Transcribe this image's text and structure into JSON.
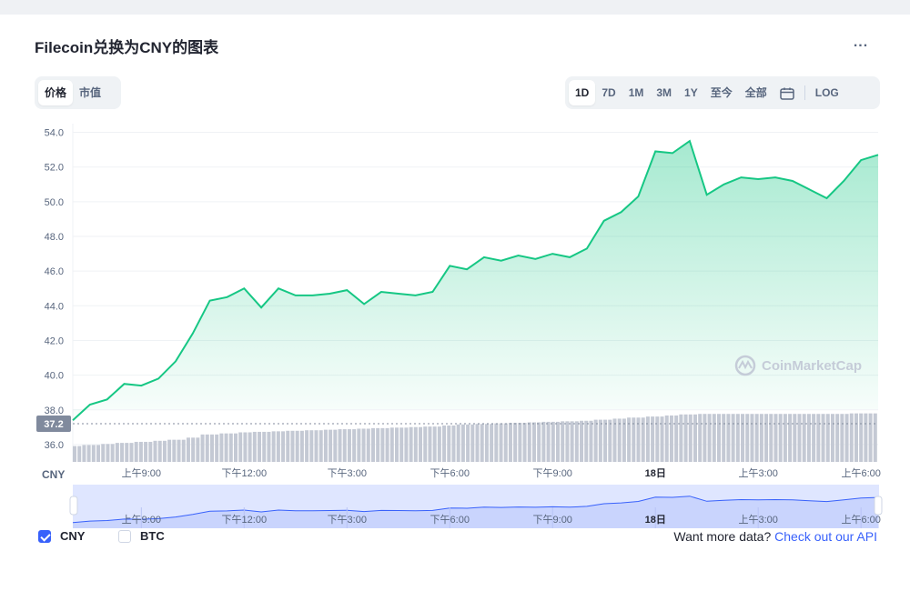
{
  "title": "Filecoin兑换为CNY的图表",
  "more_label": "...",
  "tabs_left": [
    {
      "label": "价格",
      "active": true
    },
    {
      "label": "市值",
      "active": false
    }
  ],
  "tabs_right": [
    {
      "label": "1D",
      "active": true
    },
    {
      "label": "7D",
      "active": false
    },
    {
      "label": "1M",
      "active": false
    },
    {
      "label": "3M",
      "active": false
    },
    {
      "label": "1Y",
      "active": false
    },
    {
      "label": "至今",
      "active": false
    },
    {
      "label": "全部",
      "active": false
    }
  ],
  "log_label": "LOG",
  "watermark": "CoinMarketCap",
  "currency_label": "CNY",
  "colors": {
    "line": "#16c784",
    "area_top": "#16c784",
    "volume": "#c4c9d4",
    "navigator_fill": "#dfe6ff",
    "navigator_line": "#3861fb",
    "accent": "#3861fb"
  },
  "chart_data": {
    "type": "line",
    "xlabel": "",
    "ylabel": "",
    "ylim": [
      35,
      54.5
    ],
    "yticks": [
      "54.0",
      "52.0",
      "50.0",
      "48.0",
      "46.0",
      "44.0",
      "42.0",
      "40.0",
      "38.0",
      "36.0"
    ],
    "ytick_values": [
      54,
      52,
      50,
      48,
      46,
      44,
      42,
      40,
      38,
      36
    ],
    "xticks": [
      "上午9:00",
      "下午12:00",
      "下午3:00",
      "下午6:00",
      "下午9:00",
      "18日",
      "上午3:00",
      "上午6:00"
    ],
    "xtick_hours": [
      2,
      5,
      8,
      11,
      14,
      17,
      20,
      23
    ],
    "baseline_label": "37.2",
    "baseline_value": 37.2,
    "x_hours": [
      0,
      0.5,
      1,
      1.5,
      2,
      2.5,
      3,
      3.5,
      4,
      4.5,
      5,
      5.5,
      6,
      6.5,
      7,
      7.5,
      8,
      8.5,
      9,
      9.5,
      10,
      10.5,
      11,
      11.5,
      12,
      12.5,
      13,
      13.5,
      14,
      14.5,
      15,
      15.5,
      16,
      16.5,
      17,
      17.5,
      18,
      18.5,
      19,
      19.5,
      20,
      20.5,
      21,
      21.5,
      22,
      22.5,
      23,
      23.5
    ],
    "series": [
      {
        "values": [
          37.4,
          38.3,
          38.6,
          39.5,
          39.4,
          39.8,
          40.8,
          42.4,
          44.3,
          44.5,
          45.0,
          43.9,
          45.0,
          44.6,
          44.6,
          44.7,
          44.9,
          44.1,
          44.8,
          44.7,
          44.6,
          44.8,
          46.3,
          46.1,
          46.8,
          46.6,
          46.9,
          46.7,
          47.0,
          46.8,
          47.3,
          48.9,
          49.4,
          50.3,
          52.9,
          52.8,
          53.5,
          50.4,
          51.0,
          51.4,
          51.3,
          51.4,
          51.2,
          50.7,
          50.2,
          51.2,
          52.4,
          52.7
        ],
        "volume": [
          0.3,
          0.32,
          0.34,
          0.36,
          0.38,
          0.4,
          0.42,
          0.46,
          0.52,
          0.54,
          0.56,
          0.57,
          0.58,
          0.59,
          0.6,
          0.61,
          0.62,
          0.63,
          0.64,
          0.65,
          0.66,
          0.67,
          0.69,
          0.71,
          0.72,
          0.73,
          0.74,
          0.75,
          0.76,
          0.77,
          0.78,
          0.8,
          0.82,
          0.84,
          0.86,
          0.88,
          0.9,
          0.91,
          0.91,
          0.91,
          0.91,
          0.91,
          0.91,
          0.91,
          0.91,
          0.91,
          0.92,
          0.92
        ]
      }
    ]
  },
  "footer": {
    "checks": [
      {
        "label": "CNY",
        "checked": true
      },
      {
        "label": "BTC",
        "checked": false
      }
    ],
    "more_text": "Want more data?",
    "link_text": "Check out our API"
  }
}
